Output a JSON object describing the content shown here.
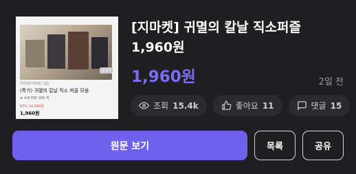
{
  "product": {
    "title": "[지마켓] 귀멸의 칼날 직소퍼즐 1,960원",
    "price": "1,960원",
    "time_ago": "2일 전"
  },
  "thumbnail": {
    "badge": "1/10",
    "seller": "지마켓(지마켓/그룹)",
    "name": "(특가) 귀멸의 칼날 직소 퍼즐 모음",
    "rating": "★ 4.8 리뷰 163 개",
    "discount": "87% 14,900원",
    "price": "1,960원"
  },
  "stats": {
    "views_label": "조회",
    "views_value": "15.4k",
    "likes_label": "좋아요",
    "likes_value": "11",
    "comments_label": "댓글",
    "comments_value": "15"
  },
  "actions": {
    "view_original": "원문 보기",
    "list": "목록",
    "share": "공유"
  },
  "colors": {
    "accent": "#7060ee",
    "background": "#1f1f21",
    "chip": "#2b2b2e"
  }
}
